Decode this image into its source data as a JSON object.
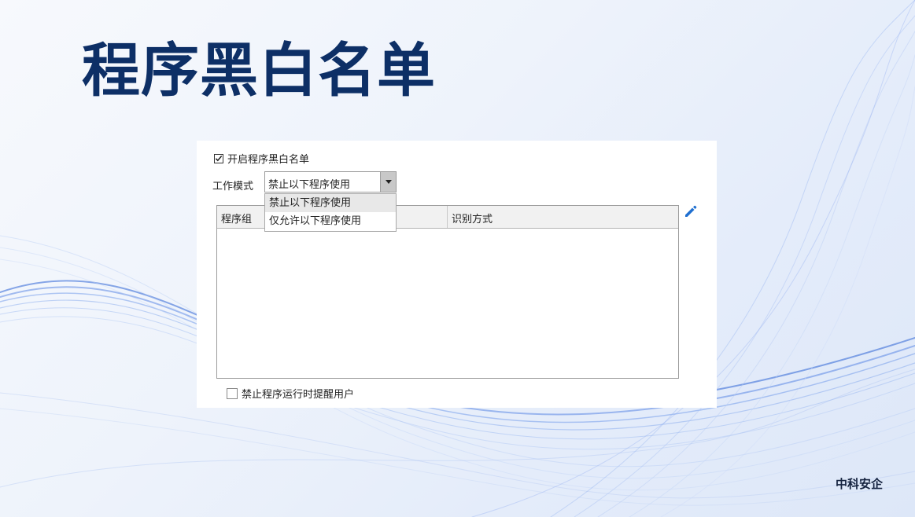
{
  "slide": {
    "title": "程序黑白名单",
    "brand": "中科安企"
  },
  "panel": {
    "enable_checkbox": {
      "label": "开启程序黑白名单",
      "checked": true
    },
    "work_mode": {
      "label": "工作模式",
      "selected": "禁止以下程序使用",
      "options": [
        "禁止以下程序使用",
        "仅允许以下程序使用"
      ]
    },
    "table": {
      "columns": [
        "程序组",
        "识别方式"
      ],
      "rows": []
    },
    "edit_icon": "pencil-icon",
    "notify_checkbox": {
      "label": "禁止程序运行时提醒用户",
      "checked": false
    }
  },
  "colors": {
    "title": "#0d2f66",
    "accent_blue": "#1f6fd0",
    "wave_blue": "#2c63d6"
  }
}
